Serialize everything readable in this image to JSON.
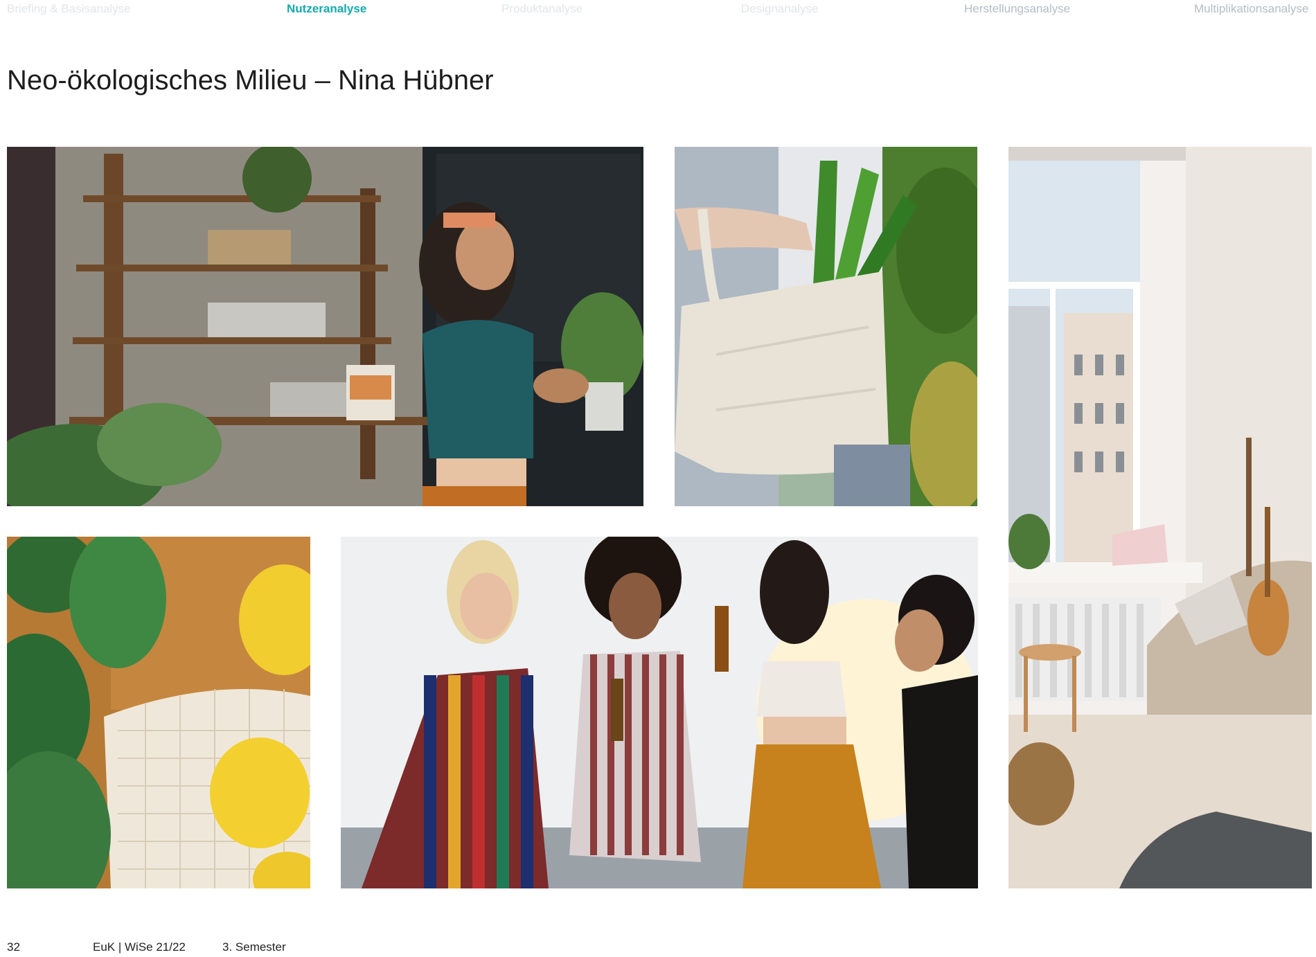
{
  "nav": {
    "items": [
      {
        "label": "Briefing & Basisanalyse",
        "state": "faint"
      },
      {
        "label": "Nutzeranalyse",
        "state": "active"
      },
      {
        "label": "Produktanalyse",
        "state": "faint"
      },
      {
        "label": "Designanalyse",
        "state": "faint"
      },
      {
        "label": "Herstellungsanalyse",
        "state": "muted"
      },
      {
        "label": "Multiplikationsanalyse",
        "state": "muted"
      }
    ],
    "colors": {
      "active": "#14aaaf",
      "muted": "#b3bdc6",
      "faint": "#e1e6ea"
    }
  },
  "page": {
    "title": "Neo-ökologisches Milieu – Nina Hübner"
  },
  "footer": {
    "page_number": "32",
    "course": "EuK  |  WiSe 21/22",
    "semester": "3. Semester"
  }
}
